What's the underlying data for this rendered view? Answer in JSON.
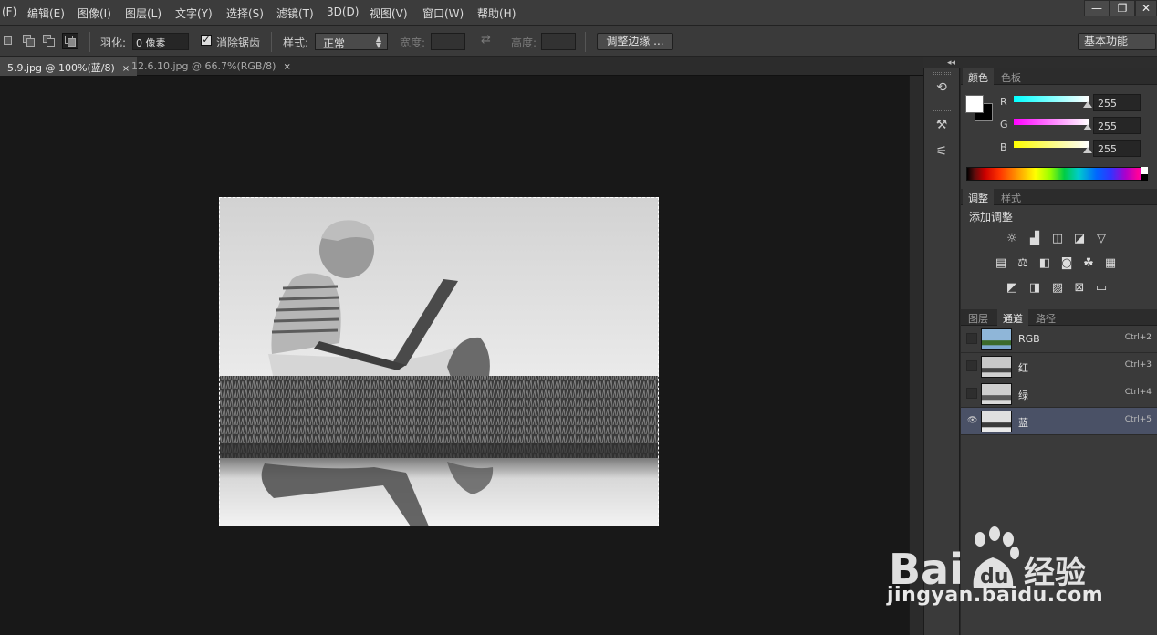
{
  "menu": {
    "items": [
      "(F)",
      "编辑(E)",
      "图像(I)",
      "图层(L)",
      "文字(Y)",
      "选择(S)",
      "滤镜(T)",
      "3D(D)",
      "视图(V)",
      "窗口(W)",
      "帮助(H)"
    ]
  },
  "window": {
    "minimize": "—",
    "restore": "❐",
    "close": "✕"
  },
  "options": {
    "feather_label": "羽化:",
    "feather_value": "0 像素",
    "antialias_label": "消除锯齿",
    "antialias_checked": "✓",
    "style_label": "样式:",
    "style_value": "正常",
    "width_label": "宽度:",
    "height_label": "高度:",
    "refine_edge": "调整边缘 ...",
    "workspace": "基本功能"
  },
  "tabs": [
    {
      "label": "5.9.jpg @ 100%(蓝/8)",
      "close": "×"
    },
    {
      "label": "12.6.10.jpg @ 66.7%(RGB/8)",
      "close": "×"
    }
  ],
  "panel_collapse": "◂◂",
  "color_panel": {
    "tabs": [
      "颜色",
      "色板"
    ],
    "channels": [
      {
        "label": "R",
        "value": "255",
        "color": "#00ffff"
      },
      {
        "label": "G",
        "value": "255",
        "color": "#ff00ff"
      },
      {
        "label": "B",
        "value": "255",
        "color": "#ffff00"
      }
    ]
  },
  "adjust_panel": {
    "tabs": [
      "调整",
      "样式"
    ],
    "title": "添加调整",
    "row1_icons": [
      "brightness-icon",
      "levels-icon",
      "curves-icon",
      "exposure-icon",
      "vibrance-icon"
    ],
    "row2_icons": [
      "hue-saturation-icon",
      "color-balance-icon",
      "black-white-icon",
      "photo-filter-icon",
      "channel-mixer-icon",
      "color-lookup-icon"
    ],
    "row3_icons": [
      "invert-icon",
      "posterize-icon",
      "threshold-icon",
      "selective-color-icon",
      "gradient-map-icon"
    ]
  },
  "channels_panel": {
    "tabs": [
      "图层",
      "通道",
      "路径"
    ],
    "rows": [
      {
        "name": "RGB",
        "shortcut": "Ctrl+2",
        "eye": "",
        "kind": "rgb"
      },
      {
        "name": "红",
        "shortcut": "Ctrl+3",
        "eye": "",
        "kind": "gray"
      },
      {
        "name": "绿",
        "shortcut": "Ctrl+4",
        "eye": "",
        "kind": "gray"
      },
      {
        "name": "蓝",
        "shortcut": "Ctrl+5",
        "eye": "👁",
        "kind": "gray"
      }
    ]
  },
  "watermark": {
    "text": "jingyan.baidu.com"
  }
}
